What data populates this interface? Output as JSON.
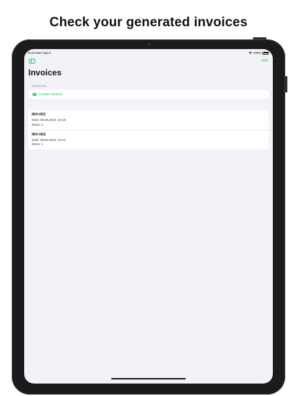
{
  "headline": "Check your generated invoices",
  "status_bar": {
    "time": "22:43 Mon Sep 9",
    "battery": "100%"
  },
  "nav": {
    "edit_label": "Edit",
    "title": "Invoices"
  },
  "section": {
    "header": "INVOICES",
    "create_label": "Create Invoice"
  },
  "invoices": [
    {
      "id": "INV-001",
      "date": "Date: 09.09.2024, 22:10",
      "items": "Items: 1"
    },
    {
      "id": "INV-002",
      "date": "Date: 09.09.2024, 22:12",
      "items": "Items: 1"
    }
  ],
  "colors": {
    "accent": "#34c759",
    "background": "#f2f2f7"
  },
  "icons": [
    "sidebar-toggle-icon",
    "wifi-icon",
    "battery-icon",
    "plus-circle-icon",
    "chevron-right-icon"
  ]
}
